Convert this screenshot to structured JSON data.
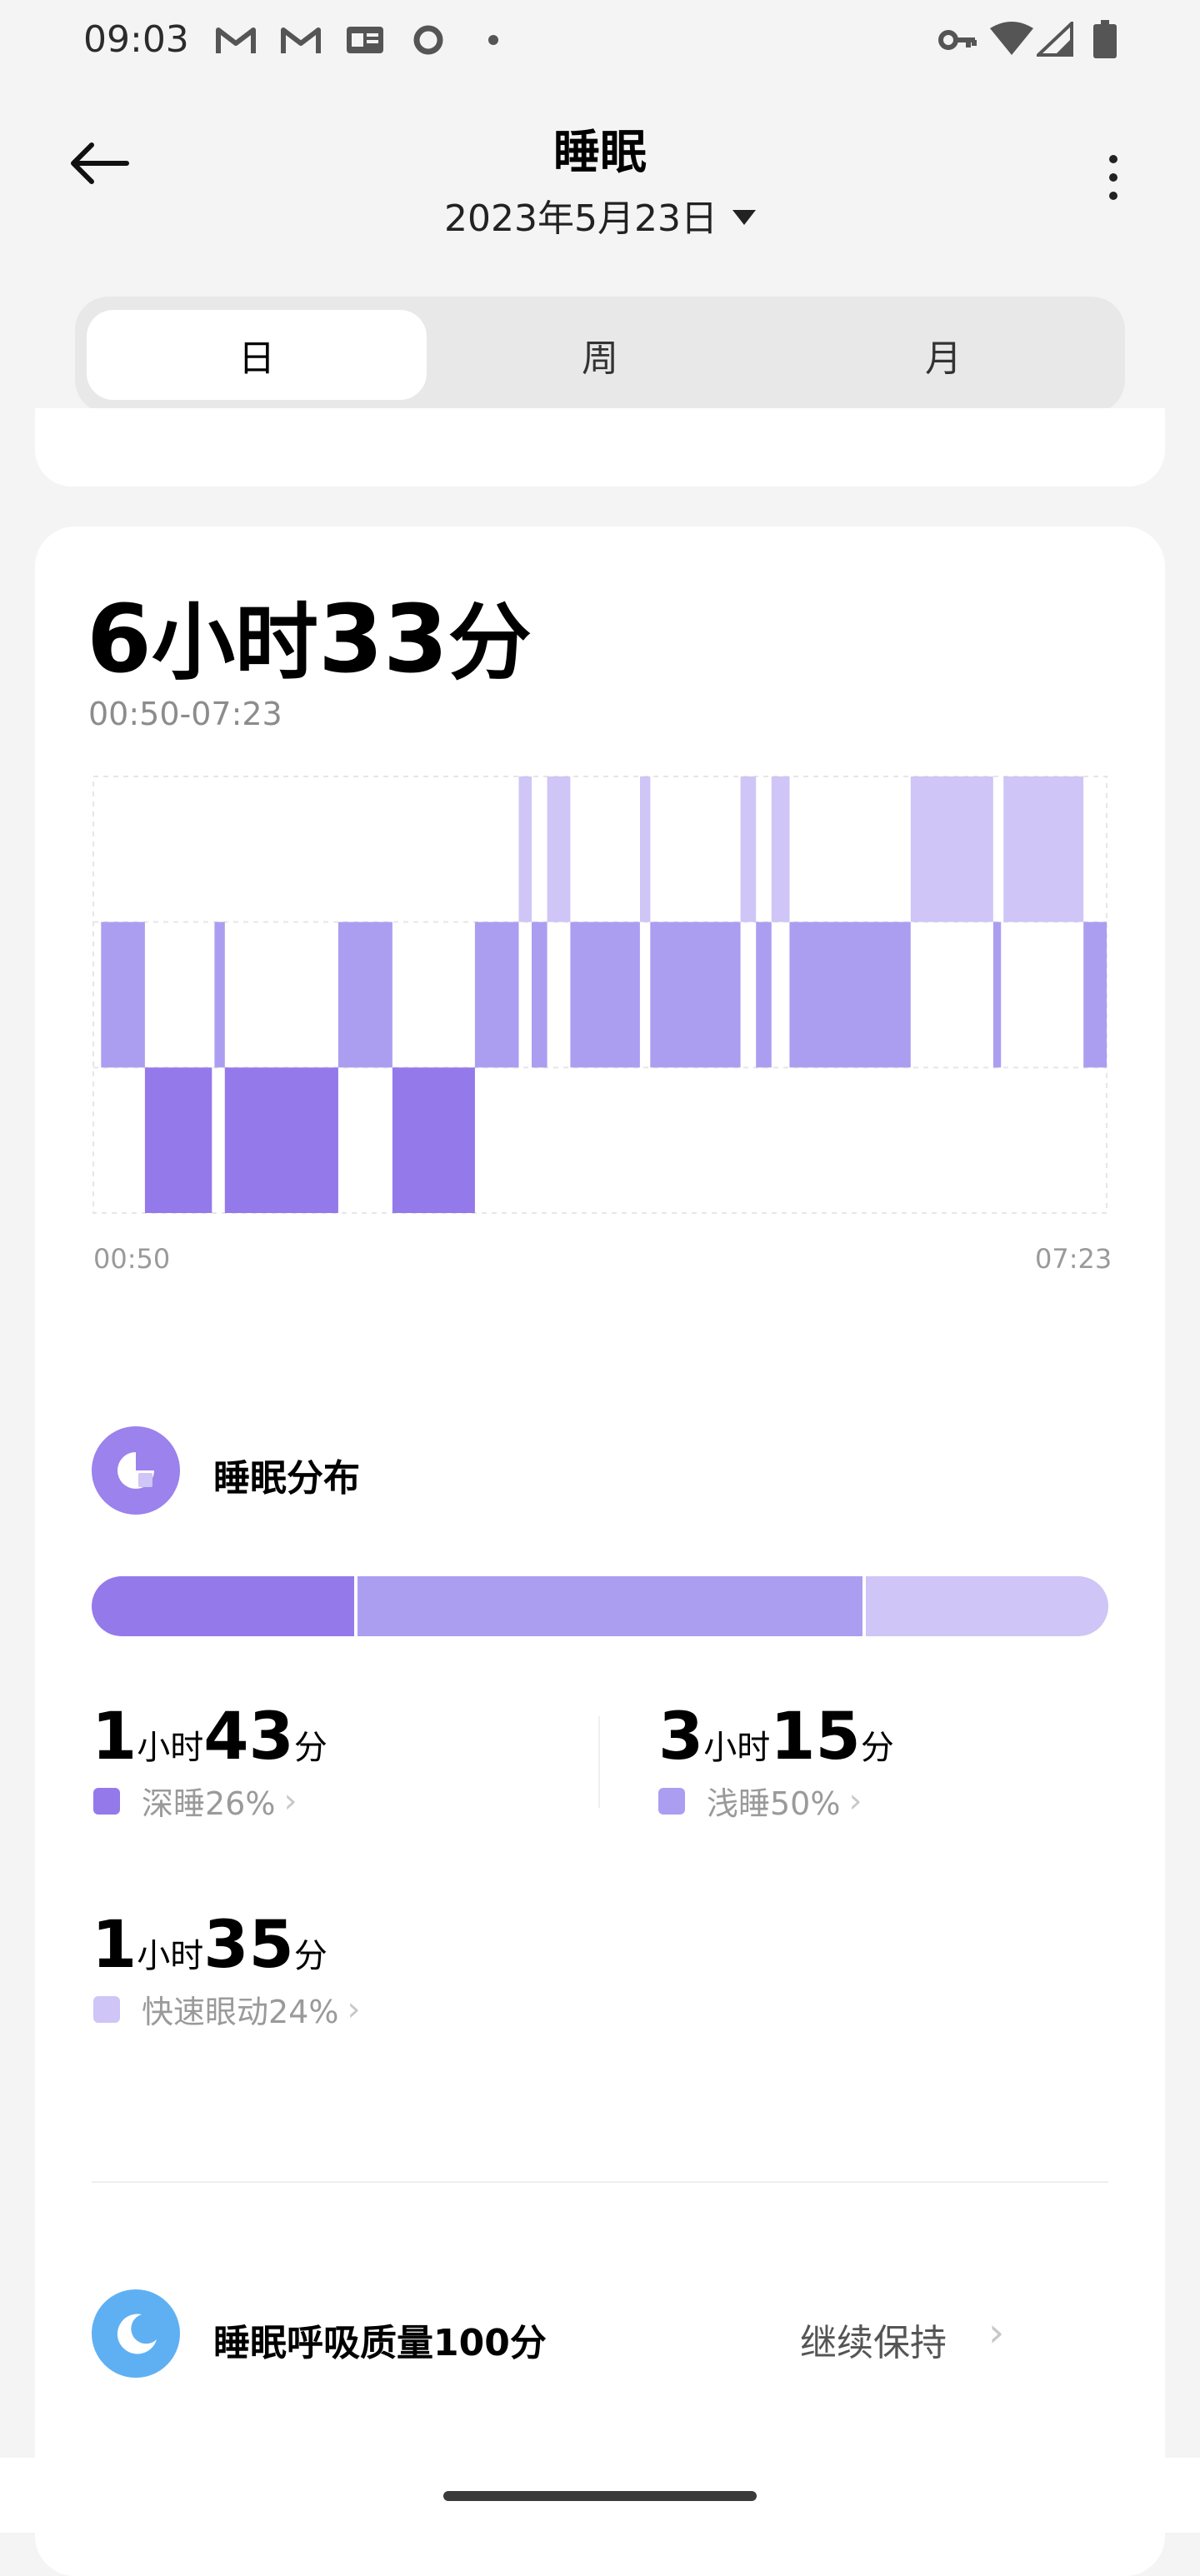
{
  "status_bar": {
    "time": "09:03",
    "notification_icons": [
      "gmail-icon",
      "gmail-icon",
      "news-icon",
      "circle-icon",
      "dot-icon"
    ],
    "system_icons": [
      "vpn-key-icon",
      "wifi-icon",
      "signal-icon",
      "battery-icon"
    ]
  },
  "header": {
    "title": "睡眠",
    "date": "2023年5月23日"
  },
  "tabs": [
    {
      "label": "日",
      "active": true
    },
    {
      "label": "周",
      "active": false
    },
    {
      "label": "月",
      "active": false
    }
  ],
  "summary": {
    "hours": "6",
    "hours_unit": "小时",
    "minutes": "33",
    "minutes_unit": "分",
    "time_range": "00:50-07:23"
  },
  "chart_data": {
    "type": "hypnogram",
    "x_start_label": "00:50",
    "x_end_label": "07:23",
    "x_range_minutes": [
      0,
      393
    ],
    "levels": [
      "rem",
      "light",
      "deep"
    ],
    "colors": {
      "rem": "#cfc5f6",
      "light": "#ab9ef1",
      "deep": "#9479ea"
    },
    "segments": [
      {
        "start": 3,
        "end": 20,
        "stage": "light"
      },
      {
        "start": 20,
        "end": 46,
        "stage": "deep"
      },
      {
        "start": 47,
        "end": 51,
        "stage": "light"
      },
      {
        "start": 51,
        "end": 95,
        "stage": "deep"
      },
      {
        "start": 95,
        "end": 116,
        "stage": "light"
      },
      {
        "start": 116,
        "end": 148,
        "stage": "deep"
      },
      {
        "start": 148,
        "end": 165,
        "stage": "light"
      },
      {
        "start": 165,
        "end": 170,
        "stage": "rem"
      },
      {
        "start": 170,
        "end": 176,
        "stage": "light"
      },
      {
        "start": 176,
        "end": 185,
        "stage": "rem"
      },
      {
        "start": 185,
        "end": 212,
        "stage": "light"
      },
      {
        "start": 212,
        "end": 216,
        "stage": "rem"
      },
      {
        "start": 216,
        "end": 251,
        "stage": "light"
      },
      {
        "start": 251,
        "end": 257,
        "stage": "rem"
      },
      {
        "start": 257,
        "end": 263,
        "stage": "light"
      },
      {
        "start": 263,
        "end": 270,
        "stage": "rem"
      },
      {
        "start": 270,
        "end": 317,
        "stage": "light"
      },
      {
        "start": 317,
        "end": 349,
        "stage": "rem"
      },
      {
        "start": 349,
        "end": 352,
        "stage": "light"
      },
      {
        "start": 353,
        "end": 384,
        "stage": "rem"
      },
      {
        "start": 384,
        "end": 393,
        "stage": "light"
      }
    ]
  },
  "distribution": {
    "title": "睡眠分布",
    "bar": [
      {
        "stage": "deep",
        "percent": 26,
        "color": "#9479ea"
      },
      {
        "stage": "light",
        "percent": 50,
        "color": "#ab9ef1"
      },
      {
        "stage": "rem",
        "percent": 24,
        "color": "#cfc5f6"
      }
    ],
    "stats": [
      {
        "hours": "1",
        "hours_unit": "小时",
        "minutes": "43",
        "minutes_unit": "分",
        "label": "深睡26%",
        "color": "#9479ea"
      },
      {
        "hours": "3",
        "hours_unit": "小时",
        "minutes": "15",
        "minutes_unit": "分",
        "label": "浅睡50%",
        "color": "#ab9ef1"
      },
      {
        "hours": "1",
        "hours_unit": "小时",
        "minutes": "35",
        "minutes_unit": "分",
        "label": "快速眼动24%",
        "color": "#cfc5f6"
      }
    ]
  },
  "breathing": {
    "title": "睡眠呼吸质量100分",
    "status": "继续保持"
  },
  "chevron": "›"
}
